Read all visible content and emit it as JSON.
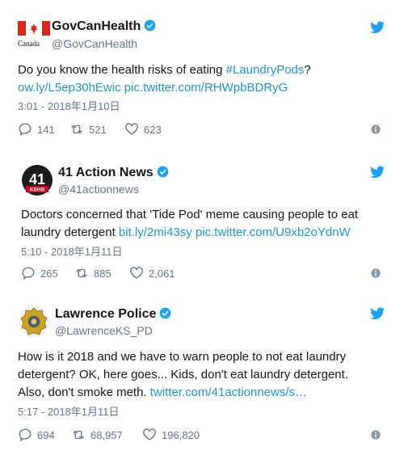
{
  "brand_color": "#1da1f2",
  "link_color": "#1b95e0",
  "tweets": [
    {
      "avatar_icon": "canada-flag-icon",
      "avatar_caption": "Canada",
      "name": "GovCanHealth",
      "handle": "@GovCanHealth",
      "text_line1_a": "Do you know the health risks of eating ",
      "text_line1_hashtag": "#LaundryPods",
      "text_line1_b": "?",
      "text_line2_link1": "ow.ly/L5ep30hEwic",
      "text_line2_link2": "pic.twitter.com/RHWpbBDRyG",
      "time": "3:01 - 2018年1月10日",
      "replies": "141",
      "retweets": "521",
      "likes": "623"
    },
    {
      "avatar_icon": "41-action-news-logo-icon",
      "avatar_number": "41",
      "avatar_sub": "KSHB",
      "name": "41 Action News",
      "handle": "@41actionnews",
      "text_line1": "Doctors concerned that 'Tide Pod' meme causing people to eat",
      "text_line2_plain": "laundry detergent ",
      "text_line2_link1": "bit.ly/2mi43sy",
      "text_line2_link2": "pic.twitter.com/U9xb2oYdnW",
      "time": "5:10 - 2018年1月11日",
      "replies": "265",
      "retweets": "885",
      "likes": "2,061"
    },
    {
      "avatar_icon": "police-badge-icon",
      "name": "Lawrence Police",
      "handle": "@LawrenceKS_PD",
      "text_line1": "How is it 2018 and we have to warn people to not eat laundry",
      "text_line2": "detergent? OK, here goes... Kids, don't eat laundry detergent.",
      "text_line3_plain": "Also, don't smoke meth. ",
      "text_line3_link": "twitter.com/41actionnews/s…",
      "time": "5:17 - 2018年1月11日",
      "replies": "694",
      "retweets": "68,957",
      "likes": "196,820"
    }
  ]
}
